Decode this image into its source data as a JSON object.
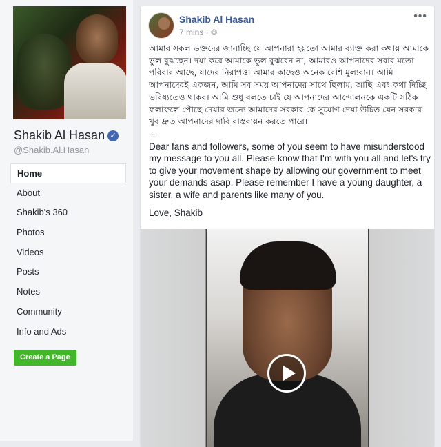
{
  "sidebar": {
    "page_name": "Shakib Al Hasan",
    "verified_icon": "verified-check-icon",
    "handle": "@Shakib.Al.Hasan",
    "nav": [
      {
        "label": "Home",
        "active": true
      },
      {
        "label": "About"
      },
      {
        "label": "Shakib's 360"
      },
      {
        "label": "Photos"
      },
      {
        "label": "Videos"
      },
      {
        "label": "Posts"
      },
      {
        "label": "Notes"
      },
      {
        "label": "Community"
      },
      {
        "label": "Info and Ads"
      }
    ],
    "create_page_label": "Create a Page"
  },
  "post": {
    "author": "Shakib Al Hasan",
    "timestamp": "7 mins",
    "privacy_icon": "globe-icon",
    "more_label": "•••",
    "bangla_text": "আমার সকল ভক্তদের জানাচ্ছি যে আপনারা হয়তো আমার ব্যাক্ত করা কথায় আমাকে ভুল বুঝছেন। দয়া করে আমাকে ভুল বুঝবেন না, আমারও আপনাদের সবার মতো পরিবার আছে, যাদের নিরাপত্তা আমার কাছেও অনেক বেশি মুল্যবান। আমি আপনাদেরই একজন, আমি সব সময় আপনাদের সাথে ছিলাম, আছি এবং কথা দিচ্ছি ভবিষ্যতেও থাকব। আমি শুধু বলতে চাই যে আপনাদের আন্দোলনকে একটি সঠিক ফলাফলে পৌছে দেয়ার জন্যে আমাদের সরকার কে সুযোগ দেয়া উচিত যেন সরকার খুব দ্রুত আপনাদের দাবি বাস্তবায়ন করতে পারে।",
    "separator": "--",
    "english_text": "Dear fans and followers, some of you seem to have misunderstood my message to you all. Please know that I'm with you all and let's try to give your movement shape by allowing our government to meet your demands asap. Please remember I have a young daughter, a sister, a wife and parents like many of you.",
    "signoff": "Love, Shakib",
    "video_play_icon": "play-icon"
  },
  "colors": {
    "link": "#365899",
    "create_button": "#42b72a",
    "verified": "#4267b2"
  }
}
